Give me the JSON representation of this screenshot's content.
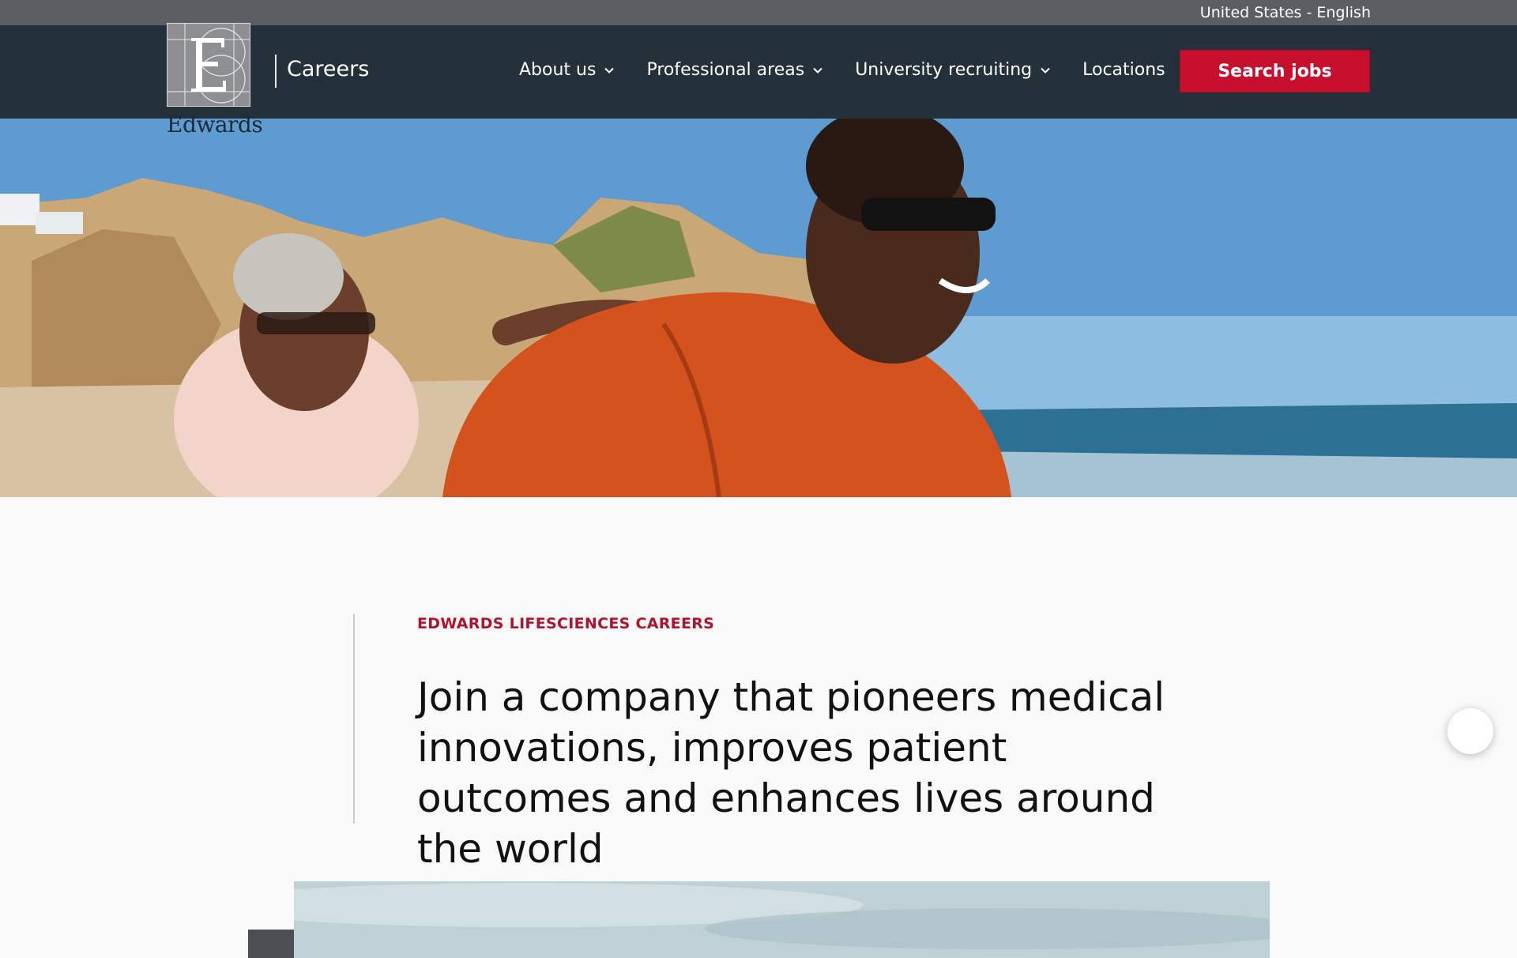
{
  "locale": {
    "label": "United States - English"
  },
  "header": {
    "logo_text": "Edwards",
    "section_title": "Careers",
    "nav": [
      {
        "label": "About us",
        "has_dropdown": true
      },
      {
        "label": "Professional areas",
        "has_dropdown": true
      },
      {
        "label": "University recruiting",
        "has_dropdown": true
      },
      {
        "label": "Locations",
        "has_dropdown": false
      }
    ],
    "cta_label": "Search jobs"
  },
  "colors": {
    "nav_bg": "#25313a",
    "util_bg": "#5b5f63",
    "accent_red": "#c8102e",
    "eyebrow_red": "#b0122f"
  },
  "intro": {
    "eyebrow": "EDWARDS LIFESCIENCES CAREERS",
    "headline": "Join a company that pioneers medical innovations, improves patient outcomes and enhances lives around the world"
  },
  "icons": [
    "chevron-down-icon",
    "edwards-logo-mark"
  ]
}
